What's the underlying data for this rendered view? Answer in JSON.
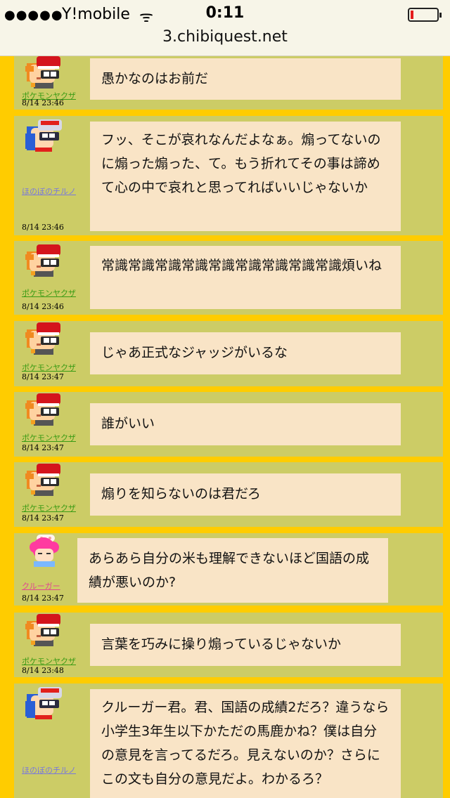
{
  "status_bar": {
    "signal": "●●●●●",
    "carrier": "Y!mobile",
    "wifi": "ᯤ",
    "time": "0:11",
    "url": "3.chibiquest.net"
  },
  "posts": [
    {
      "user": "ポケモンヤクザ",
      "time": "8/14 23:46",
      "avatar": "yakuza",
      "text": "愚かなのはお前だ"
    },
    {
      "user": "ほのぼのチルノ",
      "time": "8/14 23:46",
      "avatar": "cirno",
      "text": "フッ、そこが哀れなんだよなぁ。煽ってないのに煽った煽った、て。もう折れてその事は諦めて心の中で哀れと思ってればいいじゃないか"
    },
    {
      "user": "ポケモンヤクザ",
      "time": "8/14 23:46",
      "avatar": "yakuza",
      "text": "常識常識常識常識常識常識常識常識常識煩いね"
    },
    {
      "user": "ポケモンヤクザ",
      "time": "8/14 23:47",
      "avatar": "yakuza",
      "text": "じゃあ正式なジャッジがいるな"
    },
    {
      "user": "ポケモンヤクザ",
      "time": "8/14 23:47",
      "avatar": "yakuza",
      "text": "誰がいい"
    },
    {
      "user": "ポケモンヤクザ",
      "time": "8/14 23:47",
      "avatar": "yakuza",
      "text": "煽りを知らないのは君だろ"
    },
    {
      "user": "クルーガー",
      "time": "8/14 23:47",
      "avatar": "kruger",
      "text": "あらあら自分の米も理解できないほど国語の成績が悪いのか?"
    },
    {
      "user": "ポケモンヤクザ",
      "time": "8/14 23:48",
      "avatar": "yakuza",
      "text": "言葉を巧みに操り煽っているじゃないか"
    },
    {
      "user": "ほのぼのチルノ",
      "time": "",
      "avatar": "cirno",
      "text": "クルーガー君。君、国語の成績2だろ？違うなら小学生3年生以下かただの馬鹿かね？僕は自分の意見を言ってるだろ。見えないのか？さらにこの文も自分の意見だよ。わかるろ？"
    }
  ],
  "colors": {
    "page_background": "#ffcc00",
    "post_background": "#cccc66",
    "bubble_background": "#f9e4c6",
    "name_green": "#3a9b14",
    "name_blue": "#7878dd",
    "name_pink": "#e04690"
  }
}
